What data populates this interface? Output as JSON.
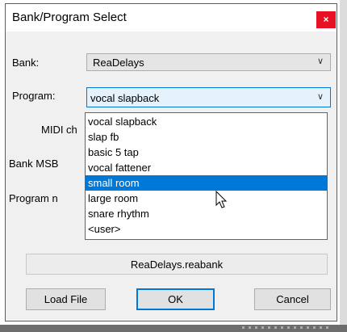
{
  "dialog": {
    "title": "Bank/Program Select",
    "close_glyph": "×"
  },
  "form": {
    "bank_label": "Bank:",
    "bank_value": "ReaDelays",
    "program_label": "Program:",
    "program_value": "vocal slapback",
    "midi_label": "MIDI ch",
    "bank_msb_label": "Bank MSB",
    "program_num_label": "Program n",
    "chevron": "∨"
  },
  "program_options": [
    "vocal slapback",
    "slap fb",
    "basic 5 tap",
    "vocal fattener",
    "small room",
    "large room",
    "snare rhythm",
    "<user>"
  ],
  "highlighted_option": "small room",
  "file_name": "ReaDelays.reabank",
  "buttons": {
    "load_file": "Load File",
    "ok": "OK",
    "cancel": "Cancel"
  },
  "colors": {
    "accent": "#0078d7",
    "close": "#e81123"
  }
}
